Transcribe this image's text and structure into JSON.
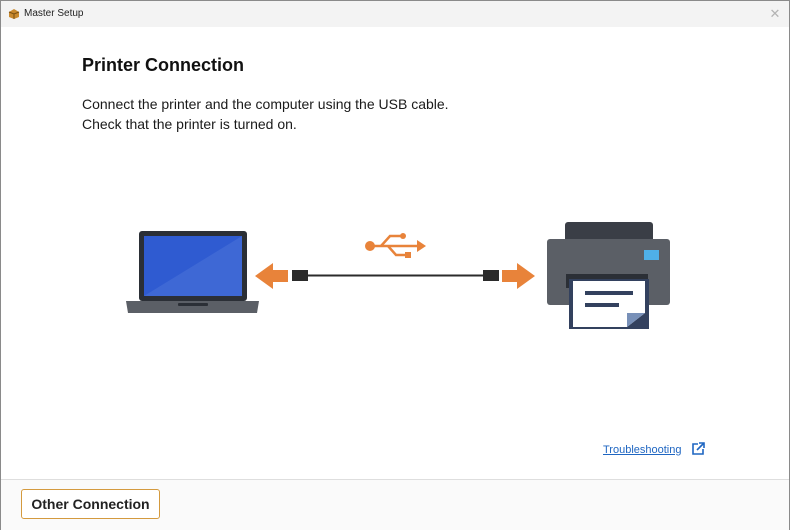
{
  "window": {
    "title": "Master Setup",
    "close_glyph": "✕"
  },
  "page": {
    "heading": "Printer Connection",
    "instructions": [
      "Connect the printer and the computer using the USB cable.",
      "Check that the printer is turned on."
    ]
  },
  "illustration": {
    "icons": [
      "laptop-icon",
      "usb-icon",
      "printer-icon",
      "arrow-left-icon",
      "arrow-right-icon"
    ],
    "accent_color": "#e8833a"
  },
  "links": {
    "troubleshooting": "Troubleshooting"
  },
  "footer": {
    "other_connection_label": "Other Connection"
  },
  "colors": {
    "link": "#1f66c2",
    "button_border": "#d49a3e",
    "screen": "#2f5bd1"
  }
}
